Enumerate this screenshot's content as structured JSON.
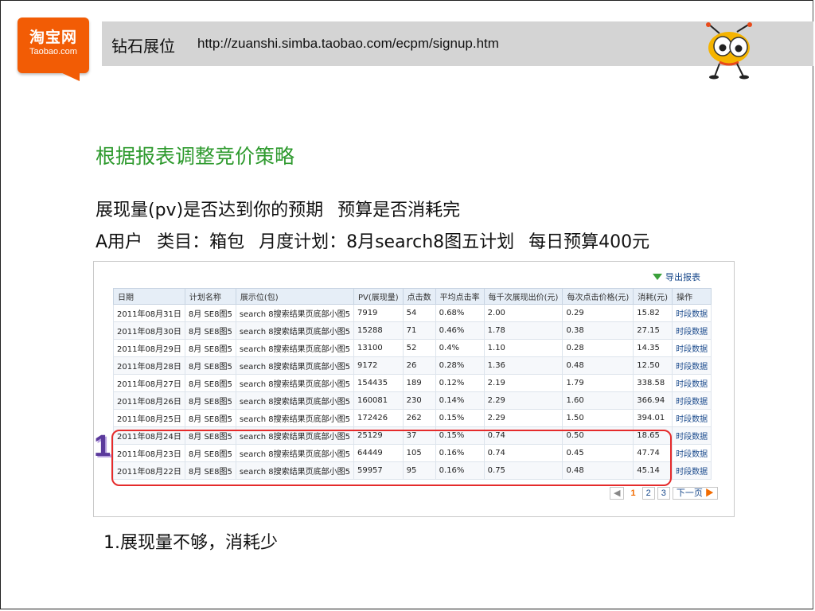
{
  "logo": {
    "cn": "淘宝网",
    "en": "Taobao.com"
  },
  "banner": {
    "title": "钻石展位",
    "url": "http://zuanshi.simba.taobao.com/ecpm/signup.htm"
  },
  "heading": "根据报表调整竞价策略",
  "line1": [
    "展现量(pv)是否达到你的预期",
    "预算是否消耗完"
  ],
  "line2": [
    "A用户",
    "类目：箱包",
    "月度计划：8月search8图五计划",
    "每日预算400元"
  ],
  "report": {
    "export_label": "导出报表",
    "headers": [
      "日期",
      "计划名称",
      "展示位(包)",
      "PV(展现量)",
      "点击数",
      "平均点击率",
      "每千次展现出价(元)",
      "每次点击价格(元)",
      "消耗(元)",
      "操作"
    ],
    "rows": [
      [
        "2011年08月31日",
        "8月 SE8图5",
        "search 8搜索结果页底部小图5",
        "7919",
        "54",
        "0.68%",
        "2.00",
        "0.29",
        "15.82",
        "时段数据"
      ],
      [
        "2011年08月30日",
        "8月 SE8图5",
        "search 8搜索结果页底部小图5",
        "15288",
        "71",
        "0.46%",
        "1.78",
        "0.38",
        "27.15",
        "时段数据"
      ],
      [
        "2011年08月29日",
        "8月 SE8图5",
        "search 8搜索结果页底部小图5",
        "13100",
        "52",
        "0.4%",
        "1.10",
        "0.28",
        "14.35",
        "时段数据"
      ],
      [
        "2011年08月28日",
        "8月 SE8图5",
        "search 8搜索结果页底部小图5",
        "9172",
        "26",
        "0.28%",
        "1.36",
        "0.48",
        "12.50",
        "时段数据"
      ],
      [
        "2011年08月27日",
        "8月 SE8图5",
        "search 8搜索结果页底部小图5",
        "154435",
        "189",
        "0.12%",
        "2.19",
        "1.79",
        "338.58",
        "时段数据"
      ],
      [
        "2011年08月26日",
        "8月 SE8图5",
        "search 8搜索结果页底部小图5",
        "160081",
        "230",
        "0.14%",
        "2.29",
        "1.60",
        "366.94",
        "时段数据"
      ],
      [
        "2011年08月25日",
        "8月 SE8图5",
        "search 8搜索结果页底部小图5",
        "172426",
        "262",
        "0.15%",
        "2.29",
        "1.50",
        "394.01",
        "时段数据"
      ],
      [
        "2011年08月24日",
        "8月 SE8图5",
        "search 8搜索结果页底部小图5",
        "25129",
        "37",
        "0.15%",
        "0.74",
        "0.50",
        "18.65",
        "时段数据"
      ],
      [
        "2011年08月23日",
        "8月 SE8图5",
        "search 8搜索结果页底部小图5",
        "64449",
        "105",
        "0.16%",
        "0.74",
        "0.45",
        "47.74",
        "时段数据"
      ],
      [
        "2011年08月22日",
        "8月 SE8图5",
        "search 8搜索结果页底部小图5",
        "59957",
        "95",
        "0.16%",
        "0.75",
        "0.48",
        "45.14",
        "时段数据"
      ]
    ],
    "pager": {
      "prev": "◀",
      "pages": [
        "1",
        "2",
        "3"
      ],
      "current_page": "1",
      "next": "下一页"
    }
  },
  "marker": "1",
  "caption": "1.展现量不够，消耗少",
  "colors": {
    "heading": "#2e9a2e",
    "logo": "#f25c05",
    "highlight": "#e52b2b",
    "link": "#1a4a8c"
  }
}
